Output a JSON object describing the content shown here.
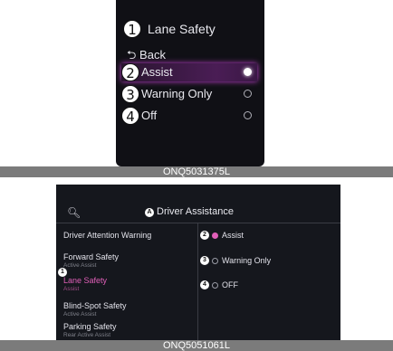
{
  "top_panel": {
    "callouts": [
      "1",
      "2",
      "3",
      "4"
    ],
    "title": "Lane Safety",
    "back_label": "Back",
    "options": [
      {
        "label": "Assist",
        "selected": true
      },
      {
        "label": "Warning Only",
        "selected": false
      },
      {
        "label": "Off",
        "selected": false
      }
    ],
    "caption": "ONQ5031375L"
  },
  "bottom_panel": {
    "title_badge": "A",
    "title": "Driver Assistance",
    "search_icon": "search-icon",
    "menu": [
      {
        "title": "Driver Attention Warning",
        "subtitle": ""
      },
      {
        "title": "Forward Safety",
        "subtitle": "Active Assist"
      },
      {
        "title": "Lane Safety",
        "subtitle": "Assist",
        "active": true
      },
      {
        "title": "Blind-Spot Safety",
        "subtitle": "Active Assist"
      },
      {
        "title": "Parking Safety",
        "subtitle": "Rear Active Assist"
      }
    ],
    "badges": [
      "1",
      "2",
      "3",
      "4"
    ],
    "options": [
      {
        "label": "Assist",
        "selected": true
      },
      {
        "label": "Warning Only",
        "selected": false
      },
      {
        "label": "OFF",
        "selected": false
      }
    ],
    "caption": "ONQ5051061L",
    "accent_color": "#e05fb8"
  }
}
